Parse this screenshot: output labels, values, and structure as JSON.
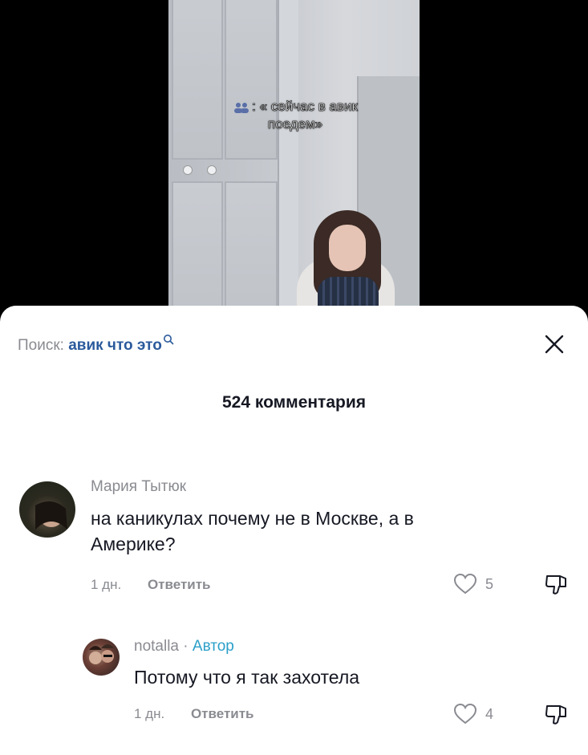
{
  "video": {
    "caption_line1": "« сейчас в авик",
    "caption_line2": "поедем»",
    "caption_icon": "people-emoji-icon"
  },
  "search": {
    "prefix": "Поиск:",
    "query": "авик что это",
    "icon": "search-icon"
  },
  "comments_header": {
    "count_label": "524 комментария"
  },
  "comments": [
    {
      "author": "Мария Тытюк",
      "text_line1": "на каникулах почему не в Москве, а в",
      "text_line2": "Америке?",
      "time": "1 дн.",
      "reply_label": "Ответить",
      "likes": "5"
    },
    {
      "author": "notalla",
      "author_separator": "·",
      "author_tag": "Автор",
      "text_line1": "Потому что я так захотела",
      "time": "1 дн.",
      "reply_label": "Ответить",
      "likes": "4"
    }
  ],
  "colors": {
    "primary_text": "#161823",
    "secondary_text": "#8a8b91",
    "search_query": "#2b5a9c",
    "author_tag": "#2b9fc9"
  }
}
